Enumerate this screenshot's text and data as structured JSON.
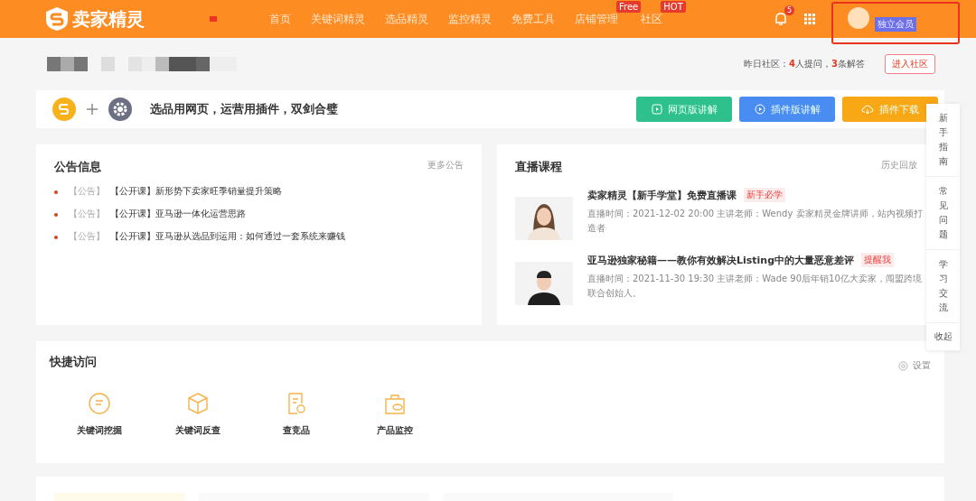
{
  "header": {
    "logo": "卖家精灵",
    "nav": [
      {
        "label": "首页"
      },
      {
        "label": "关键词精灵"
      },
      {
        "label": "选品精灵"
      },
      {
        "label": "监控精灵"
      },
      {
        "label": "免费工具"
      },
      {
        "label": "店铺管理",
        "badge": "Free"
      },
      {
        "label": "社区",
        "badge": "HOT"
      }
    ],
    "notifications": "5",
    "membership": "独立会员"
  },
  "community": {
    "label": "昨日社区：",
    "summary": "**4**人提问，**3**条解答",
    "button": "进入社区"
  },
  "banner": {
    "slogan": "选品用网页，运营用插件，双剑合璧",
    "buttons": [
      {
        "label": "网页版讲解",
        "kind": "web"
      },
      {
        "label": "插件版讲解",
        "kind": "plugin"
      },
      {
        "label": "插件下载",
        "kind": "download"
      }
    ]
  },
  "side_panel": {
    "items": [
      "新手指南",
      "常见问题",
      "学习交流"
    ],
    "collapse": "收起"
  },
  "announcements": {
    "title": "公告信息",
    "more": "更多公告",
    "items": [
      {
        "tag": "【公告】",
        "text": "【公开课】新形势下卖家旺季销量提升策略"
      },
      {
        "tag": "【公告】",
        "text": "【公开课】亚马逊一体化运营思路"
      },
      {
        "tag": "【公告】",
        "text": "【公开课】亚马逊从选品到运用：如何通过一套系统来赚钱"
      }
    ]
  },
  "live": {
    "title": "直播课程",
    "more": "历史回放",
    "courses": [
      {
        "title": "卖家精灵【新手学堂】免费直播课",
        "tag": "新手必学",
        "info": "直播时间：2021-12-02 20:00   主讲老师：Wendy  卖家精灵金牌讲师，站内视频打造者",
        "kind": "female"
      },
      {
        "title": "亚马逊独家秘籍——教你有效解决Listing中的大量恶意差评",
        "tag": "提醒我",
        "info": "直播时间：2021-11-30 19:30   主讲老师：Wade  90后年销10亿大卖家，闯盟跨境联合创始人。",
        "kind": "male"
      }
    ]
  },
  "quick_access": {
    "title": "快捷访问",
    "settings": "设置",
    "items": [
      {
        "label": "关键词挖掘",
        "kind": "mining"
      },
      {
        "label": "关键词反查",
        "kind": "reverse"
      },
      {
        "label": "查竞品",
        "kind": "competitor"
      },
      {
        "label": "产品监控",
        "kind": "monitor"
      }
    ]
  }
}
